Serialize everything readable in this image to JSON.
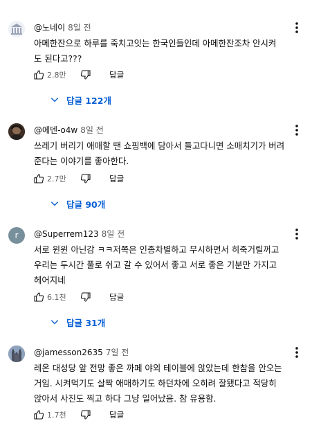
{
  "comments": [
    {
      "author": "@노네이",
      "time": "8일 전",
      "text": "아메한잔으로 하루를 죽치고잇는 한국인들인데 아메한잔조차 안시켜\n도 된다고???",
      "likes": "2.8만",
      "reply_label": "답글",
      "replies_label": "답글 122개",
      "avatar": {
        "icon": "building-columns-icon",
        "color": "#cfd6e6"
      }
    },
    {
      "author": "@에덴-o4w",
      "time": "8일 전",
      "text": "쓰레기 버리기 애매할 땐 쇼핑백에 담아서 들고다니면 소매치기가 버려\n준다는 이야기를 좋아한다.",
      "likes": "2.7만",
      "reply_label": "답글",
      "replies_label": "답글 90개",
      "avatar": {
        "icon": "photo-avatar-icon",
        "color": "#5a4636"
      }
    },
    {
      "author": "@Superrem123",
      "time": "8일 전",
      "text": "서로 윈윈 아닌감 ㅋㅋ저쪽은 인종차별하고 무시하면서 히죽거릴꺼고\n우리는 두시간 풀로 쉬고 갈 수 있어서 좋고  서로 좋은 기분만 가지고\n헤어지네",
      "likes": "6.1천",
      "reply_label": "답글",
      "replies_label": "답글 31개",
      "avatar": {
        "letter": "r",
        "color": "#78909c"
      }
    },
    {
      "author": "@jamesson2635",
      "time": "7일 전",
      "text": "레온 대성당 앞 전망 좋은 까페 야외 테이블에 앉았는데 한참을 안오는\n거임. 시켜먹기도 살짝 애매하기도 하던차에 오히려 잘됐다고 적당히\n앉아서 사진도 찍고 하다 그냥 일어났음. 참 유용함.",
      "likes": "1.7천",
      "reply_label": "답글",
      "avatar": {
        "icon": "cathedral-photo-icon",
        "color": "#6d7f98"
      }
    }
  ],
  "icons": {
    "like": "thumb-up-icon",
    "dislike": "thumb-down-icon",
    "more": "more-vert-icon",
    "expand": "chevron-down-icon"
  },
  "colors": {
    "link": "#065fd4",
    "secondary_text": "#606060"
  }
}
